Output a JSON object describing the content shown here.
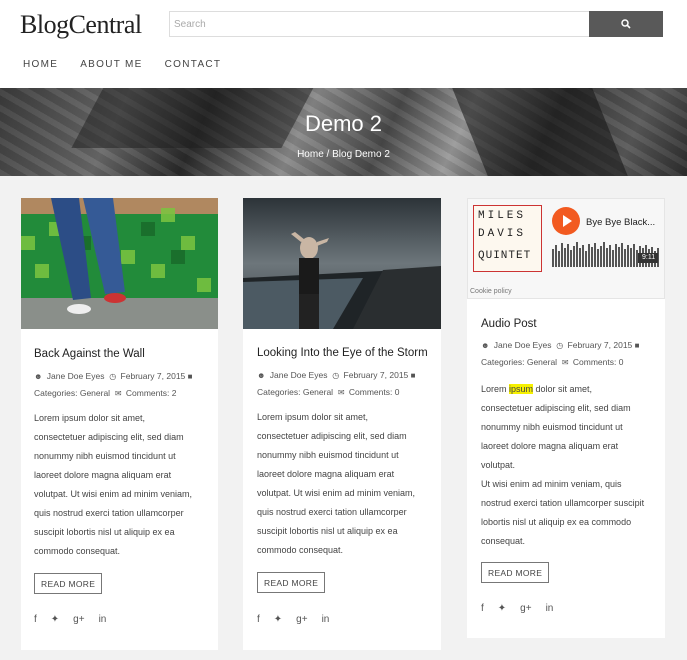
{
  "header": {
    "logo": "BlogCentral",
    "search_placeholder": "Search"
  },
  "nav": [
    "HOME",
    "ABOUT ME",
    "CONTACT"
  ],
  "banner": {
    "title": "Demo 2",
    "breadcrumb_home": "Home",
    "breadcrumb_sep": "/",
    "breadcrumb_current": "Blog Demo 2"
  },
  "posts": [
    {
      "title": "Back Against the Wall",
      "author": "Jane Doe Eyes",
      "date": "February 7, 2015",
      "categories": "Categories: General",
      "comments": "Comments: 2",
      "excerpt_lines": [
        "Lorem ipsum dolor sit amet,",
        "consectetuer adipiscing elit, sed diam",
        "nonummy nibh euismod tincidunt ut",
        "laoreet dolore magna aliquam erat",
        "volutpat. Ut wisi enim ad minim veniam,",
        "quis nostrud exerci tation ullamcorper",
        "suscipit lobortis nisl ut aliquip ex ea",
        "commodo consequat."
      ],
      "read_more": "READ MORE"
    },
    {
      "title": "Looking Into the Eye of the Storm",
      "author": "Jane Doe Eyes",
      "date": "February 7, 2015",
      "categories": "Categories: General",
      "comments": "Comments: 0",
      "excerpt_lines": [
        "Lorem ipsum dolor sit amet,",
        "consectetuer adipiscing elit, sed diam",
        "nonummy nibh euismod tincidunt ut",
        "laoreet dolore magna aliquam erat",
        "volutpat. Ut wisi enim ad minim veniam,",
        "quis nostrud exerci tation ullamcorper",
        "suscipit lobortis nisl ut aliquip ex ea",
        "commodo consequat."
      ],
      "read_more": "READ MORE"
    },
    {
      "title": "Audio Post",
      "author": "Jane Doe Eyes",
      "date": "February 7, 2015",
      "categories": "Categories: General",
      "comments": "Comments: 0",
      "excerpt_first_a": "Lorem ",
      "excerpt_highlight": "ipsum",
      "excerpt_first_b": " dolor sit amet,",
      "excerpt_lines": [
        "consectetuer adipiscing elit, sed diam",
        "nonummy nibh euismod tincidunt ut",
        "laoreet dolore magna aliquam erat",
        "volutpat.",
        "Ut wisi enim ad minim veniam, quis",
        "nostrud exerci tation ullamcorper suscipit",
        "lobortis nisl ut aliquip ex ea commodo",
        "consequat."
      ],
      "read_more": "READ MORE",
      "player": {
        "album_lines": [
          "MILES",
          "DAVIS",
          "QUINTET"
        ],
        "track": "Bye Bye Black...",
        "duration": "9:11",
        "cookie": "Cookie policy"
      }
    }
  ],
  "social_icons": [
    "facebook-icon",
    "twitter-icon",
    "google-plus-icon",
    "linkedin-icon"
  ]
}
